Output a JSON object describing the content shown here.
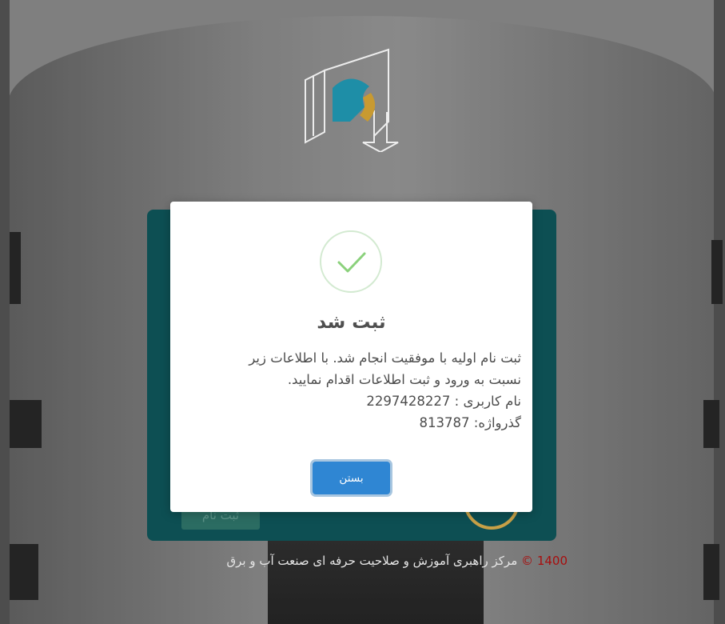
{
  "modal": {
    "title": "ثبت شد",
    "message_line1": "ثبت نام اولیه با موفقیت انجام شد. با اطلاعات زیر",
    "message_line2": "نسبت به ورود و ثبت اطلاعات اقدام نمایید.",
    "username_line": "نام کاربری : 2297428227",
    "password_line": "گذرواژه: 813787",
    "close_label": "بستن",
    "icon": "check-circle-icon",
    "accent_color": "#2f86d3",
    "success_color": "#8bd17c"
  },
  "card": {
    "button_label": "ثبت نام",
    "color": "#0d4f53"
  },
  "footer": {
    "year": "1400",
    "symbol": "©",
    "text": "مرکز راهبری آموزش و صلاحیت حرفه ای صنعت آب و برق"
  }
}
